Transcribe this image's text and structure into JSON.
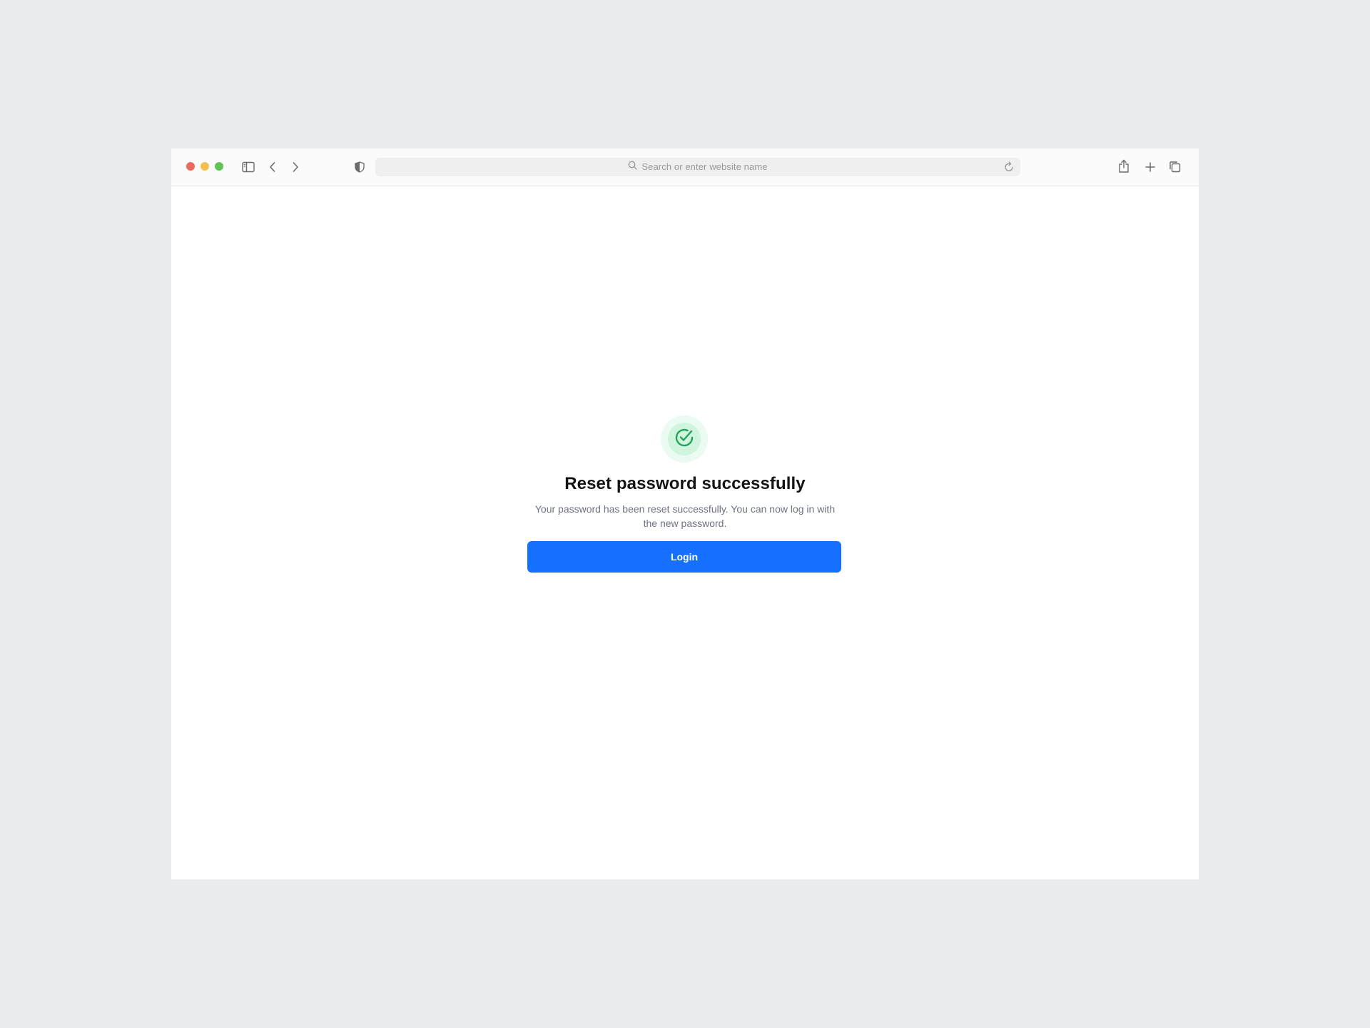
{
  "browser": {
    "address_placeholder": "Search or enter website name",
    "icons": {
      "sidebar": "sidebar-toggle-icon",
      "back": "chevron-left-icon",
      "forward": "chevron-right-icon",
      "privacy": "shield-icon",
      "search": "search-icon",
      "reload": "reload-icon",
      "share": "share-icon",
      "new_tab": "plus-icon",
      "tabs": "tab-overview-icon"
    },
    "colors": {
      "close": "#EC6A5E",
      "minimize": "#F4BF4F",
      "zoom": "#61C554"
    }
  },
  "main": {
    "title": "Reset password successfully",
    "description": "Your password has been reset successfully. You can now log in with the new password.",
    "login_label": "Login",
    "success_icon": "check-circle-icon",
    "colors": {
      "accent": "#1570FF",
      "success": "#22A559"
    }
  }
}
